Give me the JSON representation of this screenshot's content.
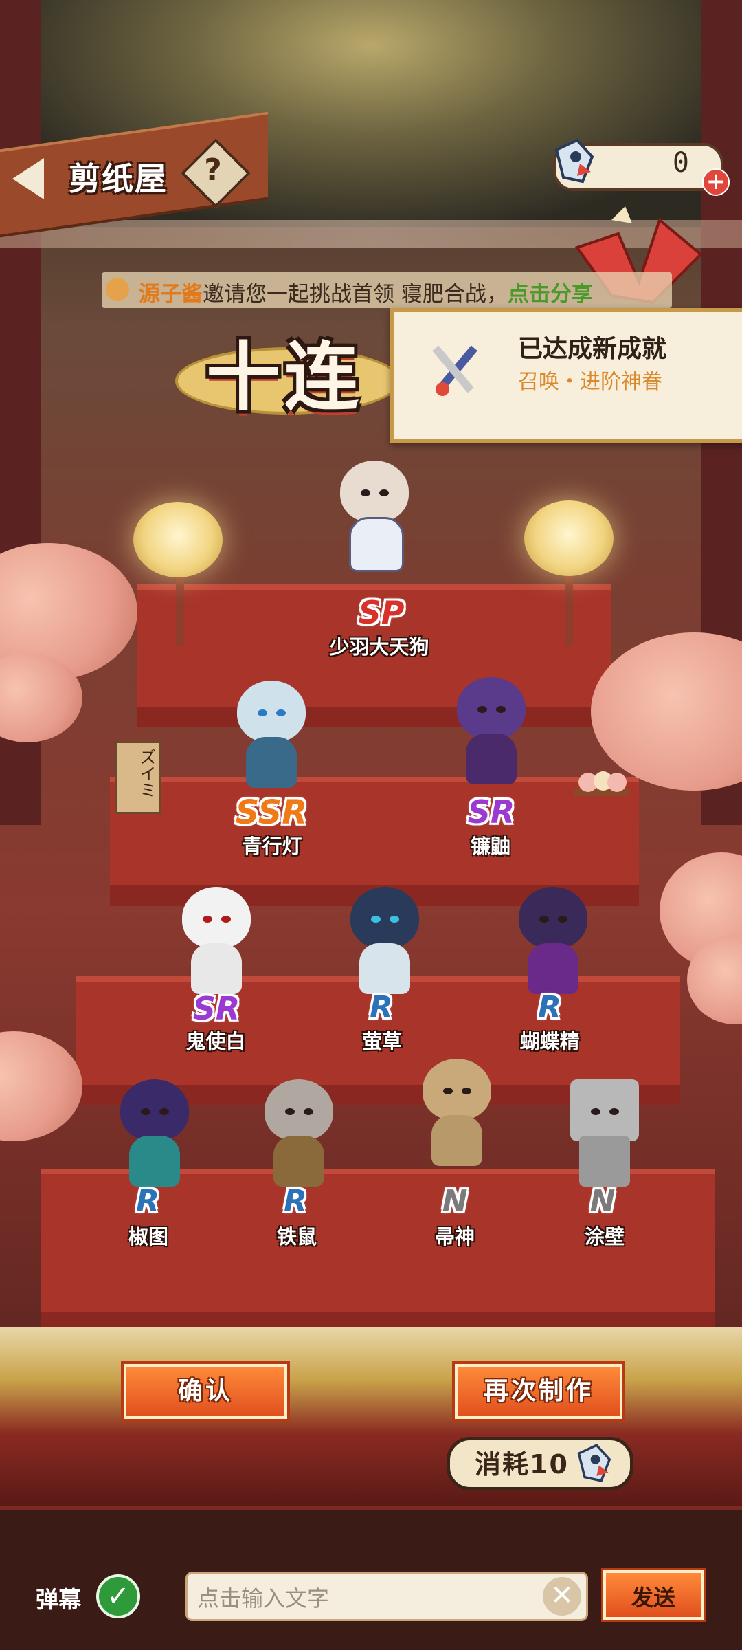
{
  "header": {
    "title": "剪纸屋",
    "help_symbol": "?",
    "currency_value": "0",
    "plus_symbol": "+"
  },
  "ticker": {
    "name": "源子酱",
    "message": "邀请您一起挑战首领 寝肥合战，",
    "link": "点击分享"
  },
  "banner_title": "十连",
  "achievement": {
    "title": "已达成新成就",
    "subtitle": "召唤・进阶神眷"
  },
  "results": [
    {
      "rarity": "SP",
      "name": "少羽大天狗"
    },
    {
      "rarity": "SSR",
      "name": "青行灯"
    },
    {
      "rarity": "SR",
      "name": "镰鼬"
    },
    {
      "rarity": "SR",
      "name": "鬼使白"
    },
    {
      "rarity": "R",
      "name": "萤草"
    },
    {
      "rarity": "R",
      "name": "蝴蝶精"
    },
    {
      "rarity": "R",
      "name": "椒图"
    },
    {
      "rarity": "R",
      "name": "铁鼠"
    },
    {
      "rarity": "N",
      "name": "帚神"
    },
    {
      "rarity": "N",
      "name": "涂壁"
    }
  ],
  "sign_text": "ズイミ",
  "buttons": {
    "confirm": "确认",
    "again": "再次制作",
    "cost": "消耗10"
  },
  "chat": {
    "danmu_label": "弹幕",
    "check_symbol": "✓",
    "placeholder": "点击输入文字",
    "clear_symbol": "✕",
    "send": "发送"
  },
  "colors": {
    "sp": "#d8302a",
    "ssr": "#f07a18",
    "sr": "#9b3ad0",
    "r": "#2c72b8",
    "n": "#7a7a7a",
    "accent_button": "#e0501e"
  },
  "icons": {
    "back": "back-arrow-icon",
    "help": "question-icon",
    "currency": "paper-doll-icon",
    "achievement": "crossed-swords-icon",
    "danmu": "check-icon",
    "clear": "close-icon"
  }
}
